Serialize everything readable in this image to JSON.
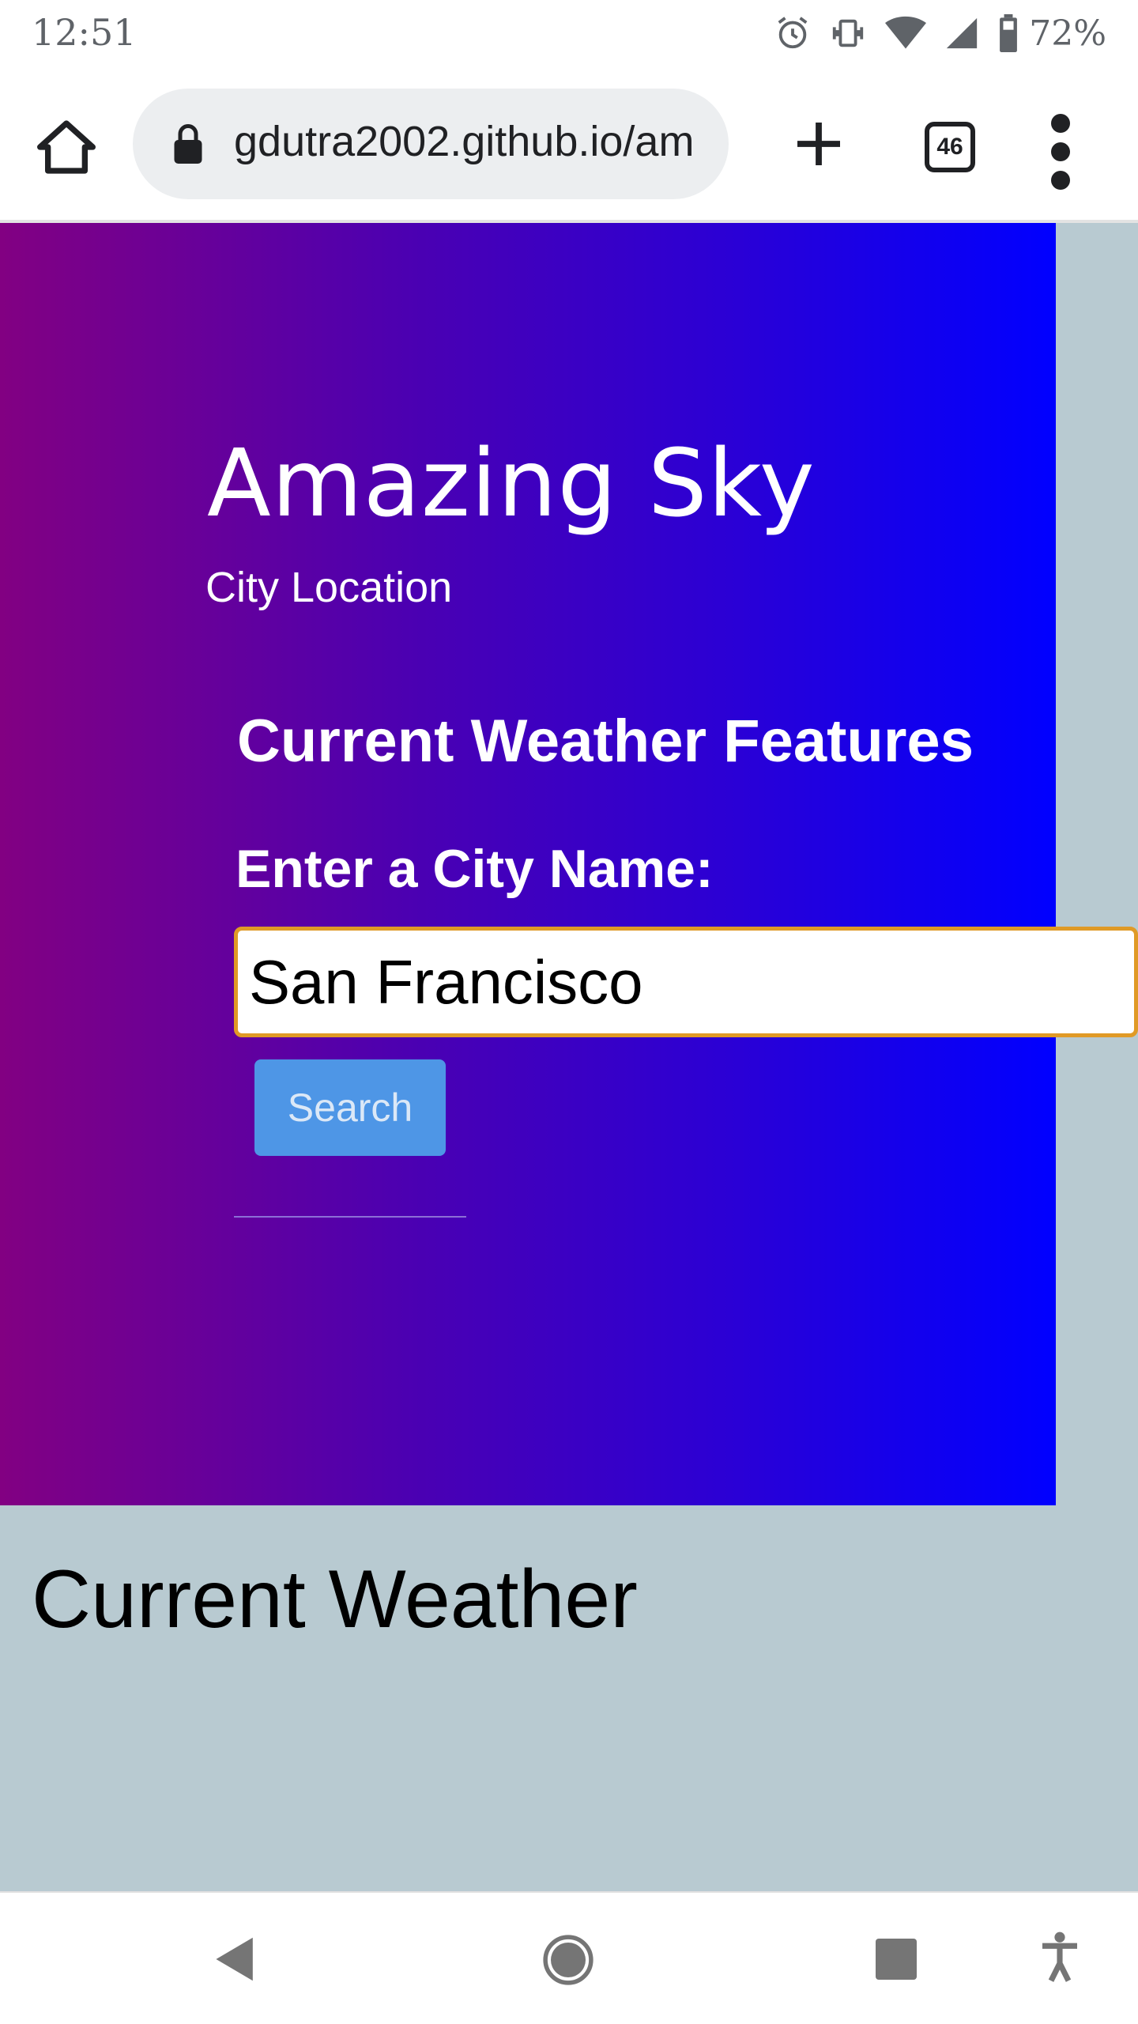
{
  "status_bar": {
    "time": "12:51",
    "battery": "72%",
    "icons": [
      "alarm-icon",
      "vibrate-icon",
      "wifi-icon",
      "signal-icon",
      "battery-icon"
    ]
  },
  "browser": {
    "url": "gdutra2002.github.io/am",
    "tab_count": "46",
    "icons": [
      "home-icon",
      "lock-icon",
      "plus-icon",
      "tabs-icon",
      "more-vert-icon"
    ]
  },
  "hero": {
    "title": "Amazing Sky",
    "subtitle": "City Location",
    "features_heading": "Current Weather Features",
    "city_label": "Enter a City Name:",
    "city_value": "San Francisco",
    "search_label": "Search",
    "gradient_colors": [
      "#820082",
      "#0000ff"
    ]
  },
  "section": {
    "current_weather_title": "Current Weather"
  },
  "nav": {
    "icons": [
      "back-icon",
      "home-circle-icon",
      "recents-icon",
      "accessibility-icon"
    ]
  },
  "colors": {
    "page_background": "#b8cad1",
    "input_border": "#e09a26",
    "search_button": "#4e96e6"
  }
}
